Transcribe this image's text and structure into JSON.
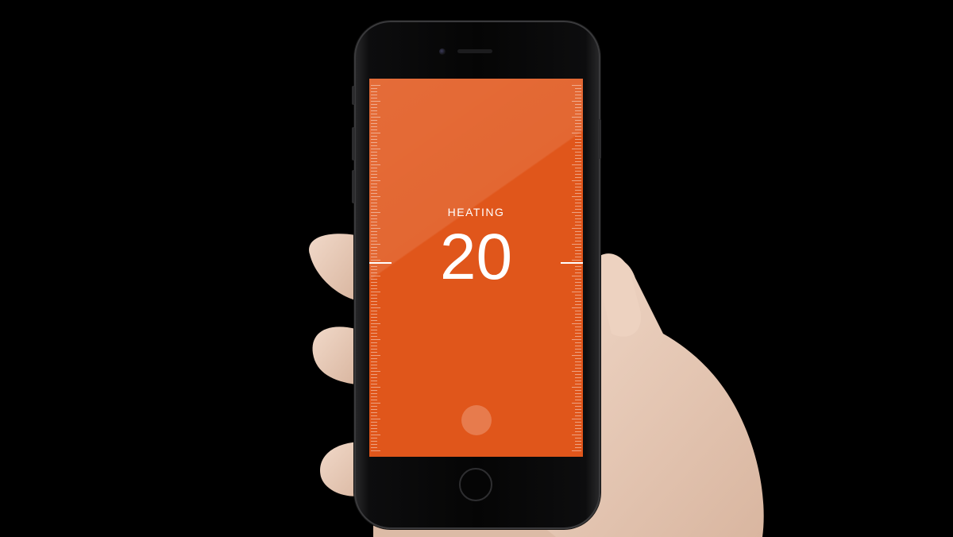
{
  "thermostat": {
    "mode_label": "HEATING",
    "temperature": "20"
  },
  "colors": {
    "screen_background": "#e0561b",
    "text": "#ffffff",
    "backdrop": "#000000"
  },
  "icons": {
    "knob": "circle-handle",
    "home": "home-button"
  }
}
